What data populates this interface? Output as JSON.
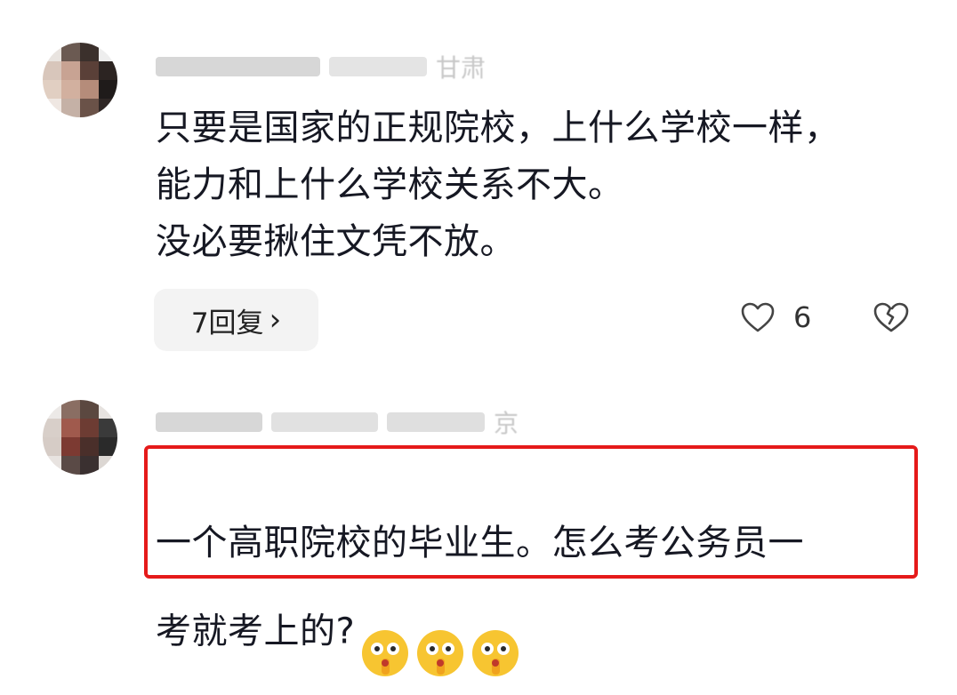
{
  "comments": [
    {
      "meta_suffix": "甘肃",
      "text": "只要是国家的正规院校，上什么学校一样，\n能力和上什么学校关系不大。\n没必要揪住文凭不放。",
      "reply_label": "7回复",
      "reply_chevron": "›",
      "like_count": "6"
    },
    {
      "meta_suffix": "京",
      "text": "一个高职院校的毕业生。怎么考公务员一\n考就考上的?",
      "emoji_icons": [
        "shush-face-emoji",
        "shush-face-emoji",
        "shush-face-emoji"
      ]
    }
  ],
  "colors": {
    "highlight_border": "#e51a1a",
    "reply_bg": "#f3f3f3",
    "meta_gray": "#b0b0b0"
  }
}
